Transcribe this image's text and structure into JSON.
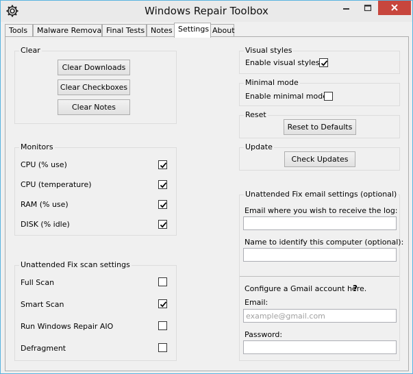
{
  "window": {
    "title": "Windows Repair Toolbox"
  },
  "tabs": [
    {
      "label": "Tools"
    },
    {
      "label": "Malware Removal"
    },
    {
      "label": "Final Tests"
    },
    {
      "label": "Notes"
    },
    {
      "label": "Settings",
      "active": true
    },
    {
      "label": "About"
    }
  ],
  "clear": {
    "title": "Clear",
    "downloads": "Clear Downloads",
    "checkboxes": "Clear Checkboxes",
    "notes": "Clear Notes"
  },
  "monitors": {
    "title": "Monitors",
    "items": [
      {
        "label": "CPU (% use)",
        "checked": true
      },
      {
        "label": "CPU (temperature)",
        "checked": true
      },
      {
        "label": "RAM (% use)",
        "checked": true
      },
      {
        "label": "DISK (% idle)",
        "checked": true
      }
    ]
  },
  "scan": {
    "title": "Unattended Fix scan settings",
    "items": [
      {
        "label": "Full Scan",
        "checked": false
      },
      {
        "label": "Smart Scan",
        "checked": true
      },
      {
        "label": "Run Windows Repair AIO",
        "checked": false
      },
      {
        "label": "Defragment",
        "checked": false
      }
    ]
  },
  "visual": {
    "title": "Visual styles",
    "label": "Enable visual styles?",
    "checked": true
  },
  "minimal": {
    "title": "Minimal mode",
    "label": "Enable minimal mode?",
    "checked": false
  },
  "reset": {
    "title": "Reset",
    "button": "Reset to Defaults"
  },
  "update": {
    "title": "Update",
    "button": "Check Updates"
  },
  "email": {
    "title": "Unattended Fix email settings  (optional)",
    "receive_label": "Email where you wish to receive the log:",
    "receive_value": "",
    "name_label": "Name to identify this computer (optional):",
    "name_value": "",
    "gmail_label": "Configure a Gmail account here.",
    "help": "?",
    "email_label": "Email:",
    "email_placeholder": "example@gmail.com",
    "password_label": "Password:",
    "password_value": ""
  }
}
